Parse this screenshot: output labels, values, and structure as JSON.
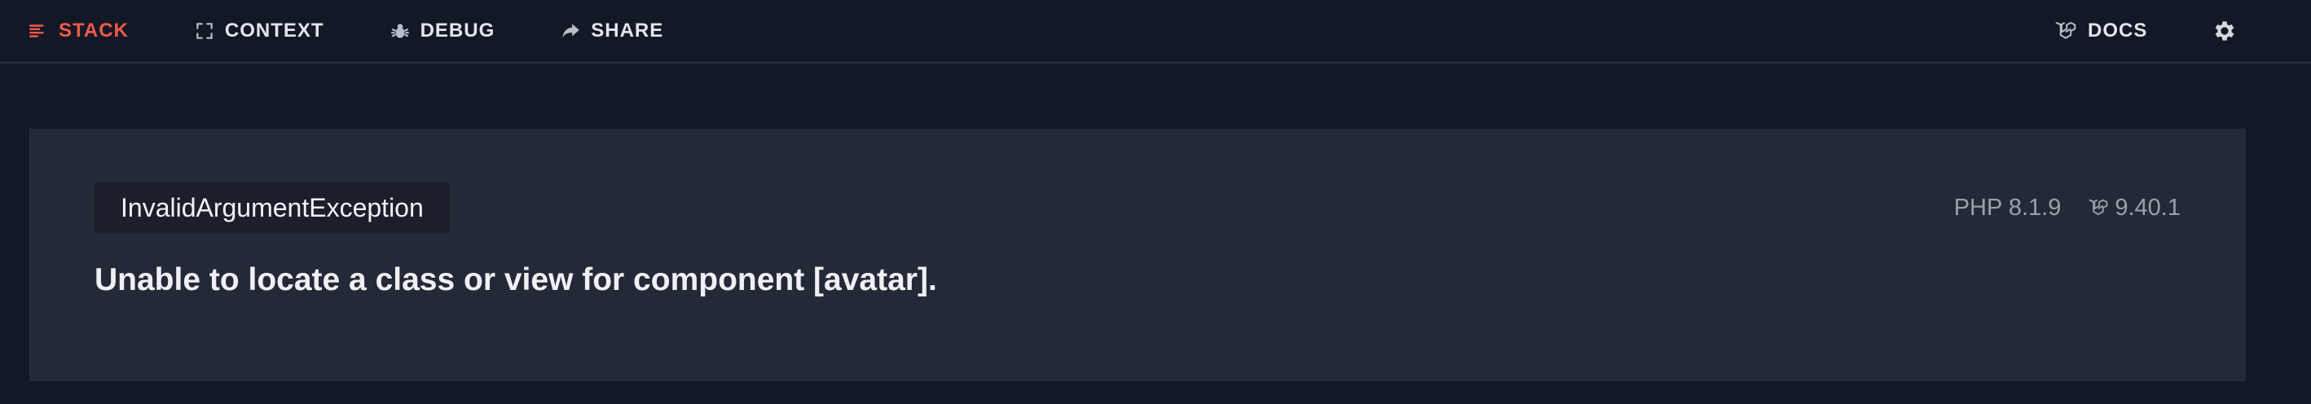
{
  "nav": {
    "items": [
      {
        "label": "STACK",
        "icon": "list-icon",
        "active": true
      },
      {
        "label": "CONTEXT",
        "icon": "expand-corners-icon",
        "active": false
      },
      {
        "label": "DEBUG",
        "icon": "bug-icon",
        "active": false
      },
      {
        "label": "SHARE",
        "icon": "share-arrow-icon",
        "active": false
      }
    ],
    "docs_label": "DOCS",
    "docs_icon": "laravel-icon",
    "settings_icon": "gear-icon"
  },
  "error": {
    "exception_class": "InvalidArgumentException",
    "message": "Unable to locate a class or view for component [avatar].",
    "php_version": "PHP 8.1.9",
    "laravel_version": "9.40.1"
  },
  "colors": {
    "background": "#131826",
    "card": "#232937",
    "accent": "#ef5a4b",
    "text": "#e2e5ea",
    "muted": "#9aa1ad"
  }
}
